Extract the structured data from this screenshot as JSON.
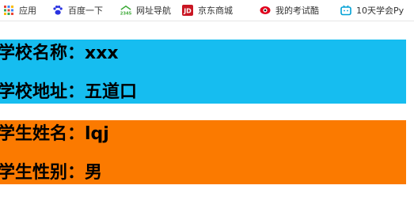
{
  "bookmarks": [
    {
      "label": "应用",
      "icon": "apps-grid-icon"
    },
    {
      "label": "百度一下",
      "icon": "baidu-paw-icon"
    },
    {
      "label": "网址导航",
      "icon": "2345-nav-icon"
    },
    {
      "label": "京东商城",
      "icon": "jd-logo-icon"
    },
    {
      "label": "我的考试酷",
      "icon": "examcoo-eye-icon"
    },
    {
      "label": "10天学会Py",
      "icon": "bilibili-tv-icon"
    }
  ],
  "school": {
    "name_label": "学校名称：",
    "name_value": "xxx",
    "address_label": "学校地址：",
    "address_value": "五道口"
  },
  "student": {
    "name_label": "学生姓名：",
    "name_value": "lqj",
    "gender_label": "学生性别：",
    "gender_value": "男"
  },
  "colors": {
    "school_panel": "#16bdf0",
    "student_panel": "#fb7a00"
  }
}
